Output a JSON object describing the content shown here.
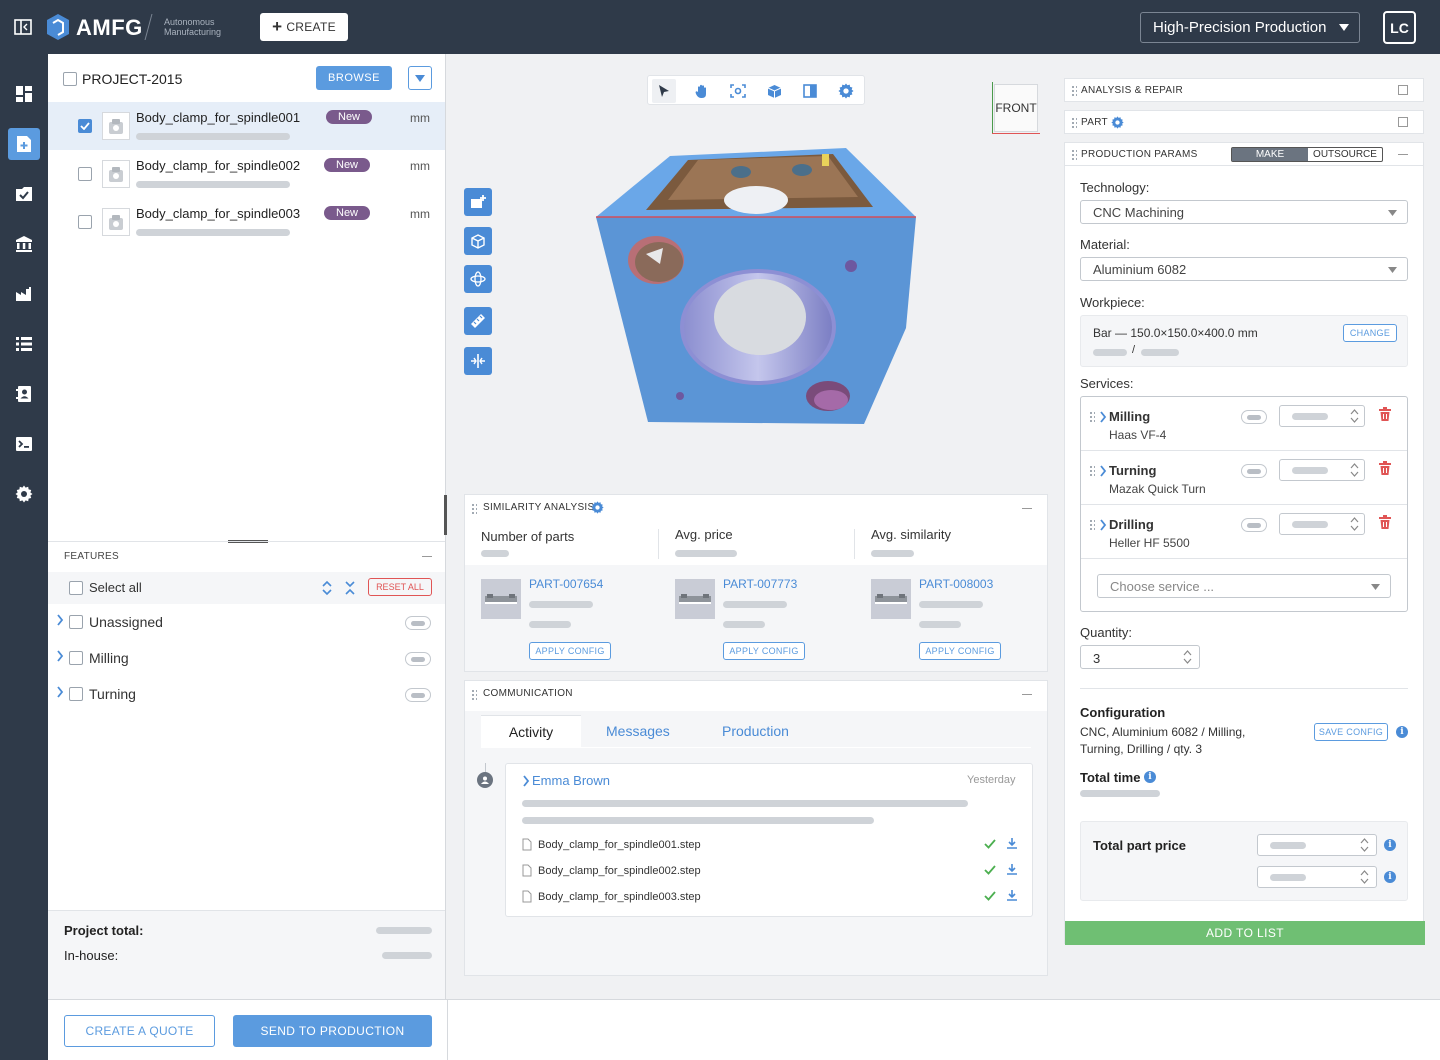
{
  "app": {
    "brand": "AMFG",
    "tagline_1": "Autonomous",
    "tagline_2": "Manufacturing",
    "create_label": "CREATE",
    "workflow": "High-Precision Production",
    "user_initials": "LC"
  },
  "sidebar": {
    "items": [
      "dashboard-icon",
      "new-part-icon",
      "orders-icon",
      "bank-icon",
      "factory-icon",
      "list-icon",
      "contacts-icon",
      "terminal-icon",
      "gear-icon"
    ]
  },
  "project": {
    "name": "PROJECT-2015",
    "browse_label": "BROWSE",
    "parts": [
      {
        "name": "Body_clamp_for_spindle001",
        "badge": "New",
        "unit": "mm",
        "checked": true
      },
      {
        "name": "Body_clamp_for_spindle002",
        "badge": "New",
        "unit": "mm",
        "checked": false
      },
      {
        "name": "Body_clamp_for_spindle003",
        "badge": "New",
        "unit": "mm",
        "checked": false
      }
    ]
  },
  "features": {
    "title": "FEATURES",
    "select_all": "Select all",
    "reset_label": "RESET ALL",
    "items": [
      "Unassigned",
      "Milling",
      "Turning"
    ]
  },
  "totals": {
    "project_total": "Project total:",
    "in_house": "In-house:"
  },
  "footer": {
    "quote_label": "CREATE A QUOTE",
    "send_label": "SEND TO PRODUCTION"
  },
  "viewer": {
    "view_cube_label": "FRONT"
  },
  "similarity": {
    "title": "SIMILARITY ANALYSIS",
    "metrics": [
      "Number of parts",
      "Avg. price",
      "Avg. similarity"
    ],
    "parts": [
      {
        "id": "PART-007654",
        "button": "APPLY CONFIG"
      },
      {
        "id": "PART-007773",
        "button": "APPLY CONFIG"
      },
      {
        "id": "PART-008003",
        "button": "APPLY CONFIG"
      }
    ]
  },
  "communication": {
    "title": "COMMUNICATION",
    "tabs": [
      "Activity",
      "Messages",
      "Production"
    ],
    "entry": {
      "author": "Emma Brown",
      "time": "Yesterday",
      "files": [
        "Body_clamp_for_spindle001.step",
        "Body_clamp_for_spindle002.step",
        "Body_clamp_for_spindle003.step"
      ]
    }
  },
  "right": {
    "analysis_title": "ANALYSIS & REPAIR",
    "part_title": "PART",
    "params_title": "PRODUCTION PARAMS",
    "make_label": "MAKE",
    "outsource_label": "OUTSOURCE",
    "technology_label": "Technology:",
    "technology_value": "CNC Machining",
    "material_label": "Material:",
    "material_value": "Aluminium 6082",
    "workpiece_label": "Workpiece:",
    "workpiece_value": "Bar — 150.0×150.0×400.0 mm",
    "change_label": "CHANGE",
    "services_label": "Services:",
    "services": [
      {
        "name": "Milling",
        "machine": "Haas VF-4"
      },
      {
        "name": "Turning",
        "machine": "Mazak Quick Turn"
      },
      {
        "name": "Drilling",
        "machine": "Heller HF 5500"
      }
    ],
    "choose_service": "Choose service ...",
    "quantity_label": "Quantity:",
    "quantity_value": "3",
    "configuration_label": "Configuration",
    "configuration_line1": "CNC, Aluminium 6082 / Milling,",
    "configuration_line2": "Turning, Drilling / qty. 3",
    "save_config": "SAVE CONFIG",
    "total_time": "Total time",
    "total_price": "Total part price",
    "add_to_list": "ADD TO LIST"
  },
  "colors": {
    "topbar": "#2f3a49",
    "accent": "#4a8bd6",
    "new_badge": "#7a5a8c",
    "add_button": "#6fbf73",
    "delete": "#e05555"
  }
}
